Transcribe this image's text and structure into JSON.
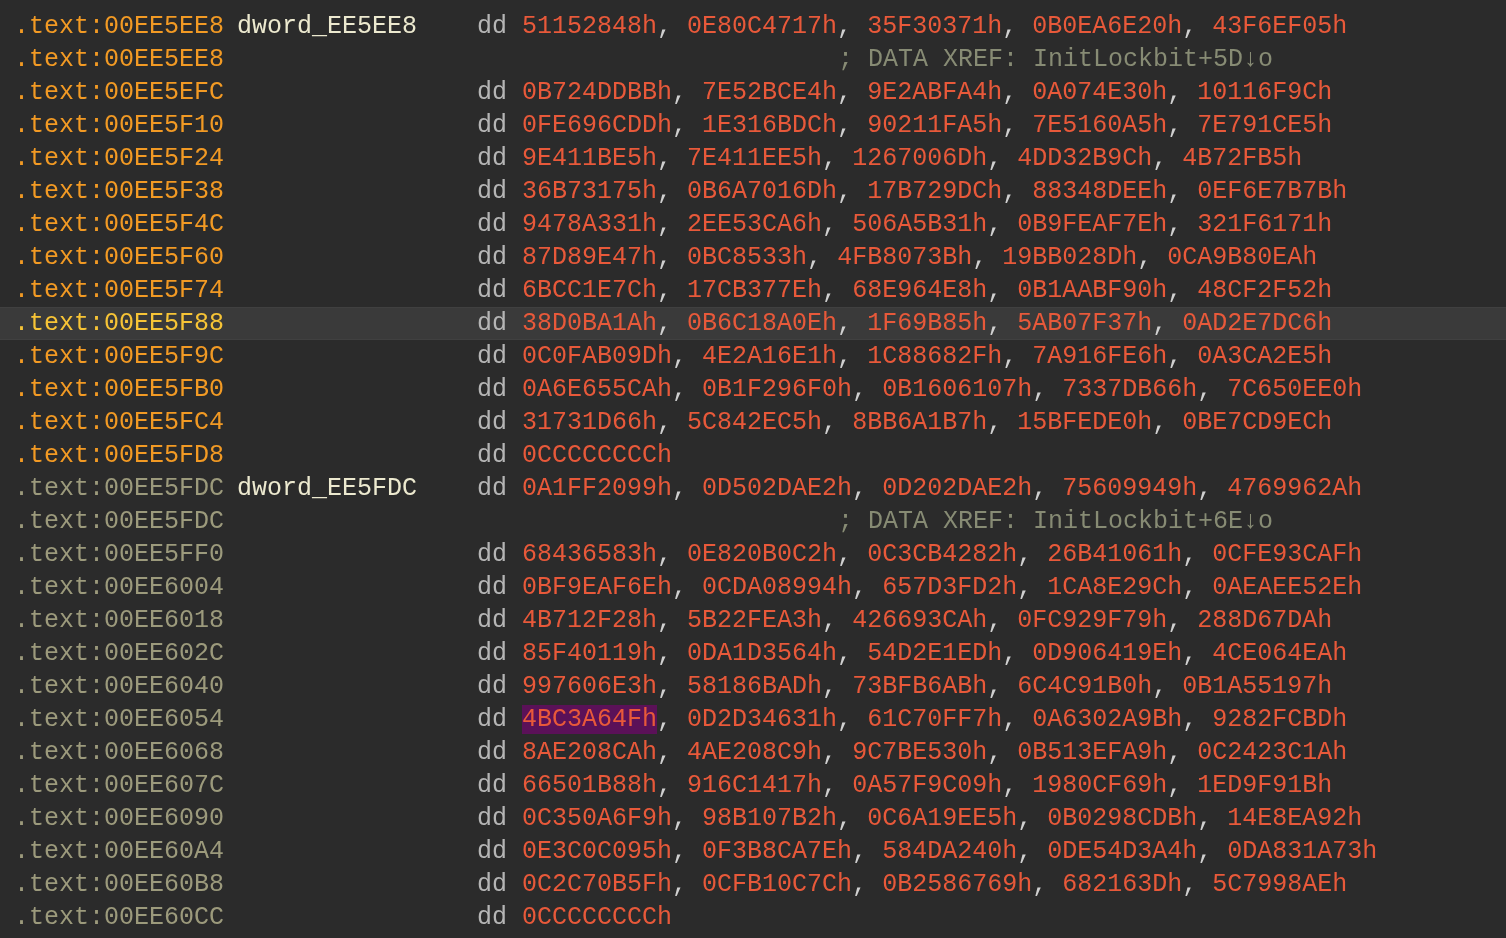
{
  "listing": {
    "lines": [
      {
        "address": ".text:00EE5EE8",
        "dimmed": false,
        "current": false,
        "label": "dword_EE5EE8",
        "directive": "dd",
        "separators": [
          ",",
          ",",
          ",",
          ","
        ],
        "values": [
          "51152848h",
          "0E80C4717h",
          "35F30371h",
          "0B0EA6E20h",
          "43F6EF05h"
        ],
        "highlight_first": false
      },
      {
        "address": ".text:00EE5EE8",
        "dimmed": false,
        "current": false,
        "comment": "; DATA XREF: InitLockbit+5D↓o"
      },
      {
        "address": ".text:00EE5EFC",
        "dimmed": false,
        "current": false,
        "directive": "dd",
        "separators": [
          ",",
          ",",
          ",",
          ","
        ],
        "values": [
          "0B724DDBBh",
          "7E52BCE4h",
          "9E2ABFA4h",
          "0A074E30h",
          "10116F9Ch"
        ],
        "highlight_first": false
      },
      {
        "address": ".text:00EE5F10",
        "dimmed": false,
        "current": false,
        "directive": "dd",
        "separators": [
          ",",
          ",",
          ",",
          ","
        ],
        "values": [
          "0FE696CDDh",
          "1E316BDCh",
          "90211FA5h",
          "7E5160A5h",
          "7E791CE5h"
        ],
        "highlight_first": false
      },
      {
        "address": ".text:00EE5F24",
        "dimmed": false,
        "current": false,
        "directive": "dd",
        "separators": [
          ",",
          ",",
          ",",
          ","
        ],
        "values": [
          "9E411BE5h",
          "7E411EE5h",
          "1267006Dh",
          "4DD32B9Ch",
          "4B72FB5h"
        ],
        "highlight_first": false
      },
      {
        "address": ".text:00EE5F38",
        "dimmed": false,
        "current": false,
        "directive": "dd",
        "separators": [
          ",",
          ",",
          ",",
          ","
        ],
        "values": [
          "36B73175h",
          "0B6A7016Dh",
          "17B729DCh",
          "88348DEEh",
          "0EF6E7B7Bh"
        ],
        "highlight_first": false
      },
      {
        "address": ".text:00EE5F4C",
        "dimmed": false,
        "current": false,
        "directive": "dd",
        "separators": [
          ",",
          ",",
          ",",
          ","
        ],
        "values": [
          "9478A331h",
          "2EE53CA6h",
          "506A5B31h",
          "0B9FEAF7Eh",
          "321F6171h"
        ],
        "highlight_first": false
      },
      {
        "address": ".text:00EE5F60",
        "dimmed": false,
        "current": false,
        "directive": "dd",
        "separators": [
          ",",
          ",",
          ",",
          ","
        ],
        "values": [
          "87D89E47h",
          "0BC8533h",
          "4FB8073Bh",
          "19BB028Dh",
          "0CA9B80EAh"
        ],
        "highlight_first": false
      },
      {
        "address": ".text:00EE5F74",
        "dimmed": false,
        "current": false,
        "directive": "dd",
        "separators": [
          ",",
          ",",
          ",",
          ","
        ],
        "values": [
          "6BCC1E7Ch",
          "17CB377Eh",
          "68E964E8h",
          "0B1AABF90h",
          "48CF2F52h"
        ],
        "highlight_first": false
      },
      {
        "address": ".text:00EE5F88",
        "dimmed": false,
        "current": true,
        "directive": "dd",
        "separators": [
          ",",
          ",",
          ",",
          ","
        ],
        "values": [
          "38D0BA1Ah",
          "0B6C18A0Eh",
          "1F69B85h",
          "5AB07F37h",
          "0AD2E7DC6h"
        ],
        "highlight_first": false
      },
      {
        "address": ".text:00EE5F9C",
        "dimmed": false,
        "current": false,
        "directive": "dd",
        "separators": [
          ",",
          ",",
          ",",
          ","
        ],
        "values": [
          "0C0FAB09Dh",
          "4E2A16E1h",
          "1C88682Fh",
          "7A916FE6h",
          "0A3CA2E5h"
        ],
        "highlight_first": false
      },
      {
        "address": ".text:00EE5FB0",
        "dimmed": false,
        "current": false,
        "directive": "dd",
        "separators": [
          ",",
          ",",
          ",",
          ","
        ],
        "values": [
          "0A6E655CAh",
          "0B1F296F0h",
          "0B1606107h",
          "7337DB66h",
          "7C650EE0h"
        ],
        "highlight_first": false
      },
      {
        "address": ".text:00EE5FC4",
        "dimmed": false,
        "current": false,
        "directive": "dd",
        "separators": [
          ",",
          ",",
          ",",
          ","
        ],
        "values": [
          "31731D66h",
          "5C842EC5h",
          "8BB6A1B7h",
          "15BFEDE0h",
          "0BE7CD9ECh"
        ],
        "highlight_first": false
      },
      {
        "address": ".text:00EE5FD8",
        "dimmed": false,
        "current": false,
        "directive": "dd",
        "values": [
          "0CCCCCCCCh"
        ],
        "highlight_first": false
      },
      {
        "address": ".text:00EE5FDC",
        "dimmed": true,
        "current": false,
        "label": "dword_EE5FDC",
        "directive": "dd",
        "separators": [
          ",",
          ",",
          ",",
          ","
        ],
        "values": [
          "0A1FF2099h",
          "0D502DAE2h",
          "0D202DAE2h",
          "75609949h",
          "4769962Ah"
        ],
        "highlight_first": false
      },
      {
        "address": ".text:00EE5FDC",
        "dimmed": true,
        "current": false,
        "comment": "; DATA XREF: InitLockbit+6E↓o"
      },
      {
        "address": ".text:00EE5FF0",
        "dimmed": true,
        "current": false,
        "directive": "dd",
        "separators": [
          ",",
          ",",
          ",",
          ","
        ],
        "values": [
          "68436583h",
          "0E820B0C2h",
          "0C3CB4282h",
          "26B41061h",
          "0CFE93CAFh"
        ],
        "highlight_first": false
      },
      {
        "address": ".text:00EE6004",
        "dimmed": true,
        "current": false,
        "directive": "dd",
        "separators": [
          ",",
          ",",
          ",",
          ","
        ],
        "values": [
          "0BF9EAF6Eh",
          "0CDA08994h",
          "657D3FD2h",
          "1CA8E29Ch",
          "0AEAEE52Eh"
        ],
        "highlight_first": false
      },
      {
        "address": ".text:00EE6018",
        "dimmed": true,
        "current": false,
        "directive": "dd",
        "separators": [
          ",",
          ",",
          ",",
          ","
        ],
        "values": [
          "4B712F28h",
          "5B22FEA3h",
          "426693CAh",
          "0FC929F79h",
          "288D67DAh"
        ],
        "highlight_first": false
      },
      {
        "address": ".text:00EE602C",
        "dimmed": true,
        "current": false,
        "directive": "dd",
        "separators": [
          ",",
          ",",
          ",",
          ","
        ],
        "values": [
          "85F40119h",
          "0DA1D3564h",
          "54D2E1EDh",
          "0D906419Eh",
          "4CE064EAh"
        ],
        "highlight_first": false
      },
      {
        "address": ".text:00EE6040",
        "dimmed": true,
        "current": false,
        "directive": "dd",
        "separators": [
          ",",
          ",",
          ",",
          ","
        ],
        "values": [
          "997606E3h",
          "58186BADh",
          "73BFB6ABh",
          "6C4C91B0h",
          "0B1A55197h"
        ],
        "highlight_first": false
      },
      {
        "address": ".text:00EE6054",
        "dimmed": true,
        "current": false,
        "directive": "dd",
        "separators": [
          ",",
          ",",
          ",",
          ","
        ],
        "values": [
          "4BC3A64Fh",
          "0D2D34631h",
          "61C70FF7h",
          "0A6302A9Bh",
          "9282FCBDh"
        ],
        "highlight_first": true
      },
      {
        "address": ".text:00EE6068",
        "dimmed": true,
        "current": false,
        "directive": "dd",
        "separators": [
          ",",
          ",",
          ",",
          ","
        ],
        "values": [
          "8AE208CAh",
          "4AE208C9h",
          "9C7BE530h",
          "0B513EFA9h",
          "0C2423C1Ah"
        ],
        "highlight_first": false
      },
      {
        "address": ".text:00EE607C",
        "dimmed": true,
        "current": false,
        "directive": "dd",
        "separators": [
          ",",
          ",",
          ",",
          ","
        ],
        "values": [
          "66501B88h",
          "916C1417h",
          "0A57F9C09h",
          "1980CF69h",
          "1ED9F91Bh"
        ],
        "highlight_first": false
      },
      {
        "address": ".text:00EE6090",
        "dimmed": true,
        "current": false,
        "directive": "dd",
        "separators": [
          ",",
          ",",
          ",",
          ","
        ],
        "values": [
          "0C350A6F9h",
          "98B107B2h",
          "0C6A19EE5h",
          "0B0298CDBh",
          "14E8EA92h"
        ],
        "highlight_first": false
      },
      {
        "address": ".text:00EE60A4",
        "dimmed": true,
        "current": false,
        "directive": "dd",
        "separators": [
          ",",
          ",",
          ",",
          ","
        ],
        "values": [
          "0E3C0C095h",
          "0F3B8CA7Eh",
          "584DA240h",
          "0DE54D3A4h",
          "0DA831A73h"
        ],
        "highlight_first": false
      },
      {
        "address": ".text:00EE60B8",
        "dimmed": true,
        "current": false,
        "directive": "dd",
        "separators": [
          ",",
          ",",
          ",",
          ","
        ],
        "values": [
          "0C2C70B5Fh",
          "0CFB10C7Ch",
          "0B2586769h",
          "682163Dh",
          "5C7998AEh"
        ],
        "highlight_first": false
      },
      {
        "address": ".text:00EE60CC",
        "dimmed": true,
        "current": false,
        "directive": "dd",
        "values": [
          "0CCCCCCCCh"
        ],
        "highlight_first": false
      }
    ]
  }
}
